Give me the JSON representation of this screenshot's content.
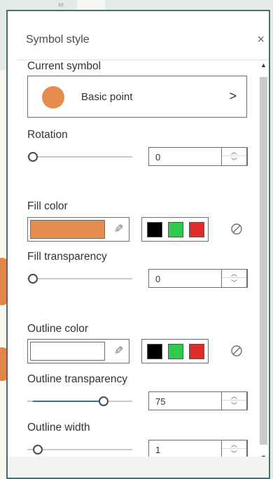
{
  "panel": {
    "title": "Symbol style",
    "close_label": "×"
  },
  "current_symbol": {
    "label": "Current symbol",
    "symbol_name": "Basic point",
    "chevron": ">",
    "symbol_color": "#e58c4f"
  },
  "rotation": {
    "label": "Rotation",
    "value": "0",
    "unit": "°",
    "slider_fraction": 0
  },
  "fill_color": {
    "label": "Fill color",
    "color": "#e58c4f",
    "palette": [
      "#000000",
      "#2ec94d",
      "#e02b2b"
    ]
  },
  "fill_transparency": {
    "label": "Fill transparency",
    "value": "0",
    "unit": "%",
    "slider_fraction": 0
  },
  "outline_color": {
    "label": "Outline color",
    "color": "#ffffff",
    "palette": [
      "#000000",
      "#2ec94d",
      "#e02b2b"
    ]
  },
  "outline_transparency": {
    "label": "Outline transparency",
    "value": "75",
    "unit": "%",
    "slider_fraction": 0.75
  },
  "outline_width": {
    "label": "Outline width",
    "value": "1",
    "unit": "px",
    "slider_fraction": 0.05
  },
  "spinner": {
    "up": "︿",
    "down": "﹀"
  },
  "scrollbar": {
    "up": "▲",
    "down": "▼"
  },
  "map_label": "S"
}
